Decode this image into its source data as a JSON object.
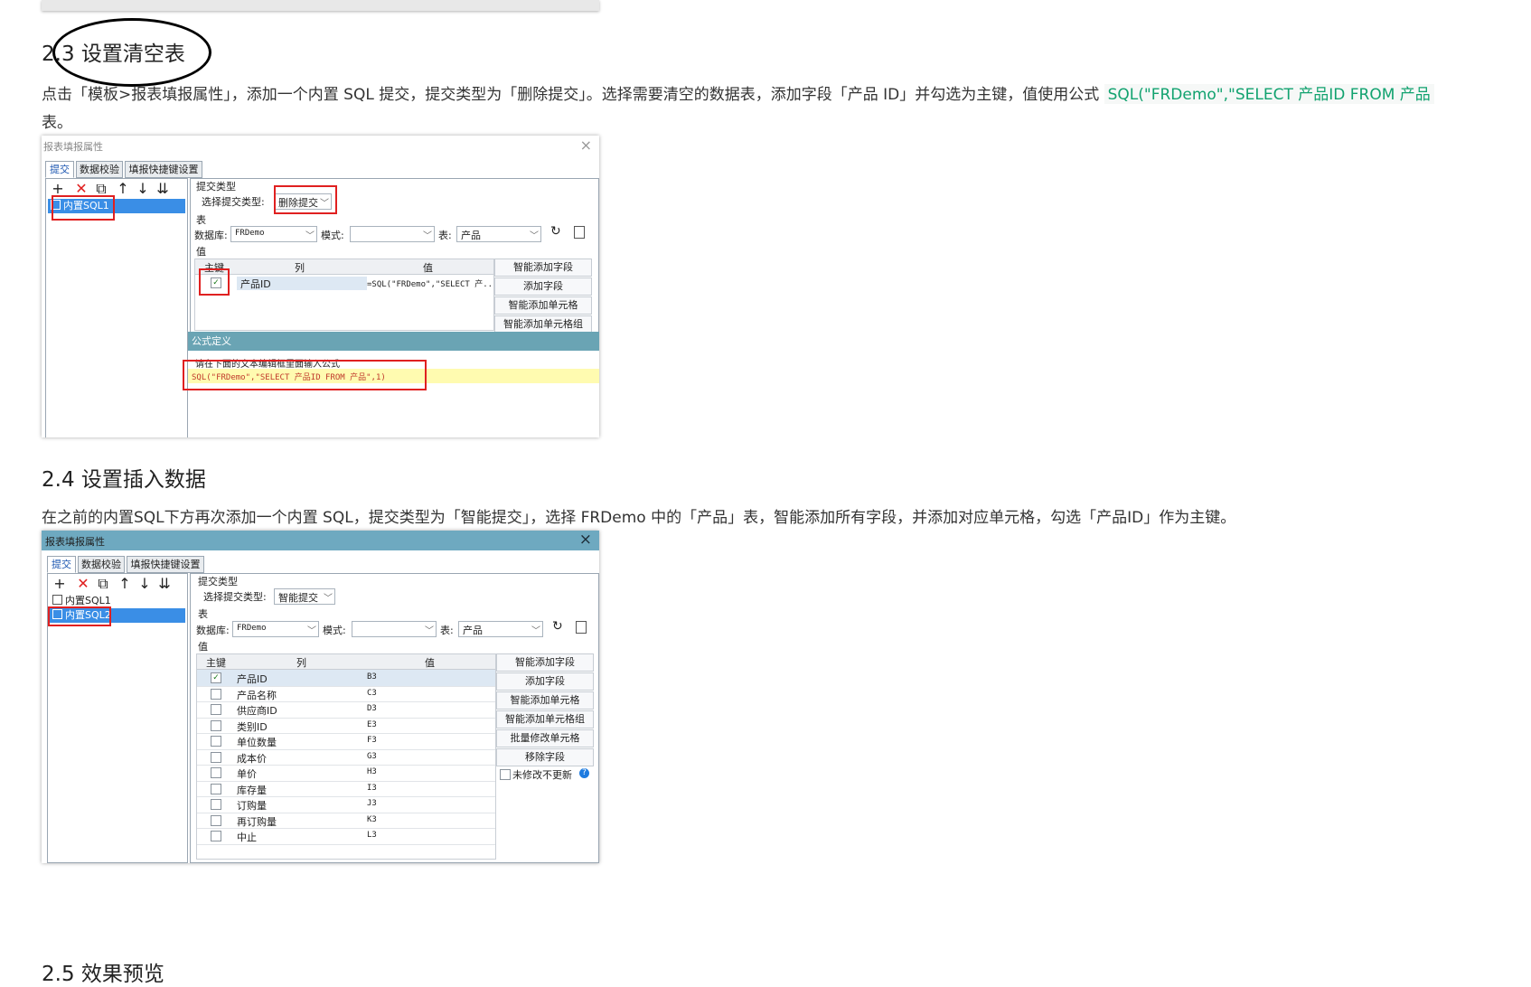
{
  "section_23": {
    "heading": "2.3 设置清空表"
  },
  "para_23": {
    "text": "点击「模板>报表填报属性」，添加一个内置 SQL 提交，提交类型为「删除提交」。选择需要清空的数据表，添加字段「产品 ID」并勾选为主键，值使用公式",
    "code": "SQL(\"FRDemo\",\"SELECT 产品ID FROM 产品",
    "tail": "表。"
  },
  "dialog1": {
    "title": "报表填报属性",
    "close_icon": "×",
    "tabs": [
      "提交",
      "数据校验",
      "填报快捷键设置"
    ],
    "tree_items": [
      "内置SQL1"
    ],
    "submit_type_group": "提交类型",
    "submit_type_label": "选择提交类型:",
    "submit_type_value": "删除提交",
    "table_group": "表",
    "db_label": "数据库:",
    "db_value": "FRDemo",
    "mode_label": "模式:",
    "mode_value": "",
    "table_label": "表:",
    "table_value": "产品",
    "value_group": "值",
    "columns": [
      "主键",
      "列",
      "值"
    ],
    "rows": [
      {
        "checked": true,
        "col": "产品ID",
        "val": "=SQL(\"FRDemo\",\"SELECT 产..."
      }
    ],
    "buttons": [
      "智能添加字段",
      "添加字段",
      "智能添加单元格",
      "智能添加单元格组"
    ],
    "formula_title": "公式定义",
    "formula_hint": "请在下面的文本编辑框里面输入公式",
    "formula_text": "SQL(\"FRDemo\",\"SELECT 产品ID FROM 产品\",1)"
  },
  "section_24": {
    "heading": "2.4 设置插入数据"
  },
  "para_24": {
    "text": "在之前的内置SQL下方再次添加一个内置 SQL，提交类型为「智能提交」，选择 FRDemo 中的「产品」表，智能添加所有字段，并添加对应单元格，勾选「产品ID」作为主键。"
  },
  "dialog2": {
    "title": "报表填报属性",
    "close_icon": "×",
    "tabs": [
      "提交",
      "数据校验",
      "填报快捷键设置"
    ],
    "tree_items": [
      "内置SQL1",
      "内置SQL2"
    ],
    "submit_type_group": "提交类型",
    "submit_type_label": "选择提交类型:",
    "submit_type_value": "智能提交",
    "table_group": "表",
    "db_label": "数据库:",
    "db_value": "FRDemo",
    "mode_label": "模式:",
    "mode_value": "",
    "table_label": "表:",
    "table_value": "产品",
    "value_group": "值",
    "columns": [
      "主键",
      "列",
      "值"
    ],
    "rows": [
      {
        "checked": true,
        "col": "产品ID",
        "val": "B3"
      },
      {
        "checked": false,
        "col": "产品名称",
        "val": "C3"
      },
      {
        "checked": false,
        "col": "供应商ID",
        "val": "D3"
      },
      {
        "checked": false,
        "col": "类别ID",
        "val": "E3"
      },
      {
        "checked": false,
        "col": "单位数量",
        "val": "F3"
      },
      {
        "checked": false,
        "col": "成本价",
        "val": "G3"
      },
      {
        "checked": false,
        "col": "单价",
        "val": "H3"
      },
      {
        "checked": false,
        "col": "库存量",
        "val": "I3"
      },
      {
        "checked": false,
        "col": "订购量",
        "val": "J3"
      },
      {
        "checked": false,
        "col": "再订购量",
        "val": "K3"
      },
      {
        "checked": false,
        "col": "中止",
        "val": "L3"
      }
    ],
    "buttons": [
      "智能添加字段",
      "添加字段",
      "智能添加单元格",
      "智能添加单元格组",
      "批量修改单元格",
      "移除字段"
    ],
    "no_update_label": "未修改不更新",
    "help_icon": "?"
  },
  "section_25": {
    "heading": "2.5 效果预览"
  },
  "toolbar_icons": {
    "add": "+",
    "delete": "✕",
    "copy": "⧉",
    "up": "↑",
    "down": "↓",
    "bottom": "⇊"
  }
}
